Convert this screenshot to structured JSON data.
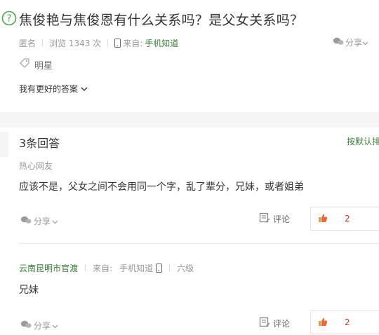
{
  "question": {
    "title": "焦俊艳与焦俊恩有什么关系吗？是父女关系吗？",
    "author": "匿名",
    "views": "浏览 1343 次",
    "source_label": "来自:",
    "source_name": "手机知道",
    "share_label": "分享",
    "tag": "明星",
    "better_answer_label": "我有更好的答案"
  },
  "answers_header": {
    "count_label": "3条回答",
    "sort_label": "按默认排"
  },
  "answers": [
    {
      "user": "热心网友",
      "text": "应该不是，父女之间不会用同一个字，乱了辈分，兄妹，或者姐弟",
      "share_label": "分享",
      "comment_label": "评论",
      "likes": "2"
    },
    {
      "user": "云南昆明市官渡",
      "source_label": "来自:",
      "source_name": "手机知道",
      "level": "六级",
      "text": "兄妹",
      "share_label": "分享",
      "comment_label": "评论",
      "likes": "2"
    }
  ],
  "colors": {
    "accent_green": "#3f7d3f",
    "like_red": "#c0392b",
    "muted": "#999999"
  }
}
